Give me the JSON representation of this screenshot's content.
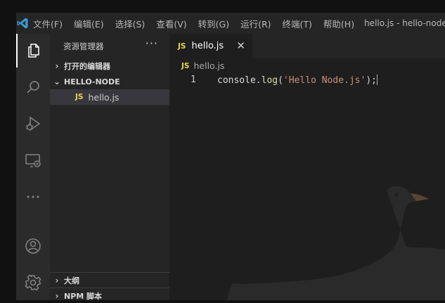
{
  "titlebar": {
    "menu": [
      "文件(F)",
      "编辑(E)",
      "选择(S)",
      "查看(V)",
      "转到(G)",
      "运行(R)",
      "终端(T)",
      "帮助(H)"
    ],
    "window_title": "hello.js - hello-node"
  },
  "activitybar": {
    "icons": [
      "explorer-icon",
      "search-icon",
      "run-debug-icon",
      "remote-explorer-icon",
      "more-icon",
      "account-icon",
      "settings-gear-icon"
    ]
  },
  "sidebar": {
    "title": "资源管理器",
    "more": "···",
    "sections": {
      "open_editors": "打开的编辑器",
      "folder": "HELLO-NODE",
      "outline": "大纲",
      "npm_scripts": "NPM 脚本"
    },
    "files": [
      {
        "badge": "JS",
        "name": "hello.js"
      }
    ]
  },
  "tabs": [
    {
      "badge": "JS",
      "title": "hello.js",
      "close": "✕"
    }
  ],
  "breadcrumb": {
    "badge": "JS",
    "file": "hello.js"
  },
  "editor": {
    "lines": [
      {
        "number": "1",
        "tokens": {
          "obj": "console",
          "dot": ".",
          "method": "log",
          "open": "(",
          "string": "'Hello Node.js'",
          "close": ");"
        }
      }
    ]
  },
  "colors": {
    "accent_logo": "#3c99d4",
    "js_badge": "#e8d44d",
    "string": "#ce9178",
    "method": "#dcdcaa"
  }
}
